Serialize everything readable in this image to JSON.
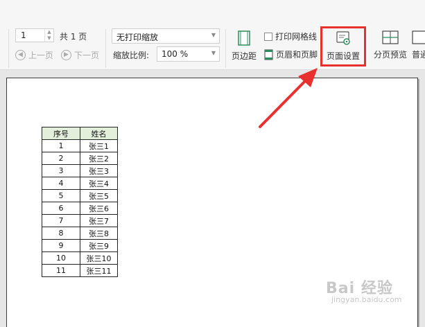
{
  "toolbar": {
    "page_number": "1",
    "total_pages": "共 1 页",
    "prev_page": "上一页",
    "next_page": "下一页",
    "print_scaling": {
      "selected": "无打印缩放"
    },
    "zoom": {
      "label": "缩放比例:",
      "value": "100 %"
    },
    "margins_label": "页边距",
    "print_gridlines_label": "打印网格线",
    "print_gridlines_checked": false,
    "header_footer_label": "页眉和页脚",
    "page_setup_label": "页面设置",
    "page_break_preview_label": "分页预览",
    "normal_view_label": "普通"
  },
  "sheet": {
    "headers": [
      "序号",
      "姓名"
    ],
    "rows": [
      [
        "1",
        "张三1"
      ],
      [
        "2",
        "张三2"
      ],
      [
        "3",
        "张三3"
      ],
      [
        "4",
        "张三4"
      ],
      [
        "5",
        "张三5"
      ],
      [
        "6",
        "张三6"
      ],
      [
        "7",
        "张三7"
      ],
      [
        "8",
        "张三8"
      ],
      [
        "9",
        "张三9"
      ],
      [
        "10",
        "张三10"
      ],
      [
        "11",
        "张三11"
      ]
    ]
  },
  "annotation": {
    "highlight_color": "#e8312f"
  },
  "watermark": {
    "text": "Bai 经验",
    "url": "jingyan.baidu.com"
  },
  "icons": {
    "margins": "page-margins-icon",
    "header_footer": "header-footer-icon",
    "page_setup": "page-setup-icon",
    "page_break_preview": "page-break-preview-icon"
  }
}
